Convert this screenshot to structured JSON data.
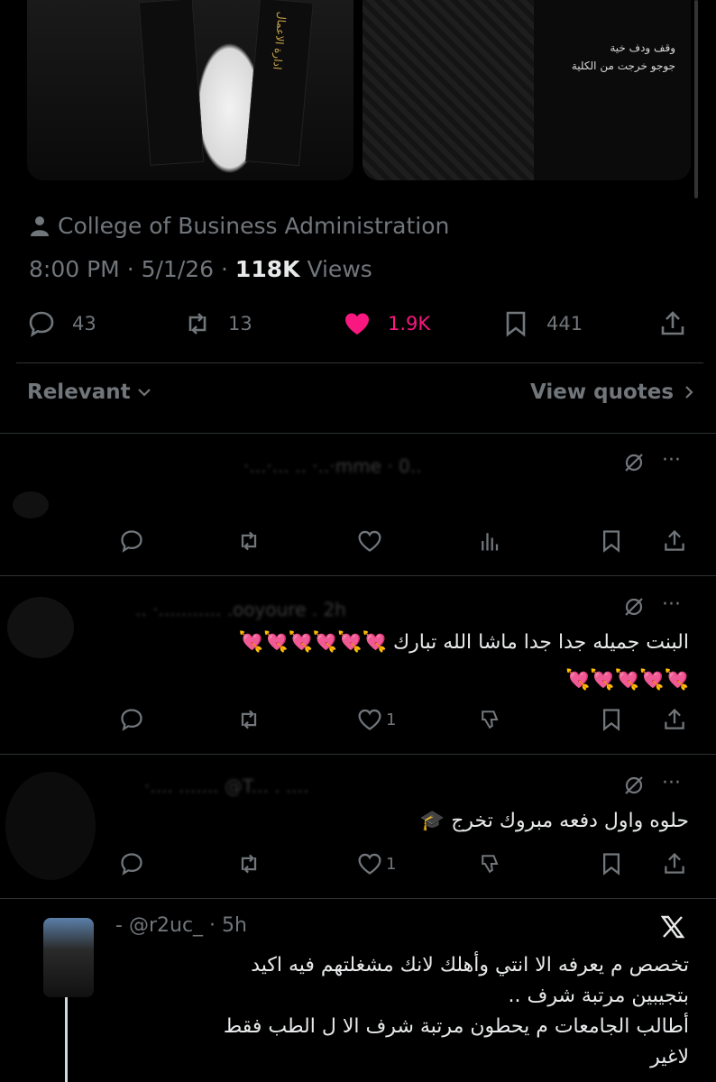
{
  "media": {
    "photo1_stole_text": "ادارة الاعمال",
    "photo2_lines": [
      "وقف ودف خية",
      "جوجو خرجت من الكلية"
    ]
  },
  "tweet": {
    "community": "College of Business Administration",
    "time": "8:00 PM",
    "date": "5/1/26",
    "views_count": "118K",
    "views_label": "Views",
    "replies": "43",
    "reposts": "13",
    "likes": "1.9K",
    "bookmarks": "441",
    "like_color": "#f91880"
  },
  "filter": {
    "sort_label": "Relevant",
    "view_quotes": "View quotes"
  },
  "replies": [
    {
      "handle_blurred": "·...·... .. ·..·mme · 0..",
      "text": "",
      "like_count": "",
      "show_views": true
    },
    {
      "handle_blurred": "..  ·........... .ooyoure . 2h",
      "text": "البنت جميله جدا جدا ماشا الله تبارك 💘💘💘💘💘💘\n💘💘💘💘💘",
      "like_count": "1",
      "show_views": false
    },
    {
      "handle_blurred": "·.... ....... @T... . ....",
      "text": "حلوه واول دفعه مبروك تخرج 🎓",
      "like_count": "1",
      "show_views": false
    }
  ],
  "quote": {
    "handle": "@r2uc_",
    "time": "5h",
    "dash": "-",
    "lines": [
      "تخصص م يعرفه الا انتي وأهلك لانك مشغلتهم فيه اكيد",
      "بتجيبين مرتبة شرف ..",
      "أطالب الجامعات م يحطون مرتبة شرف الا ل الطب فقط",
      "لاغير"
    ]
  }
}
